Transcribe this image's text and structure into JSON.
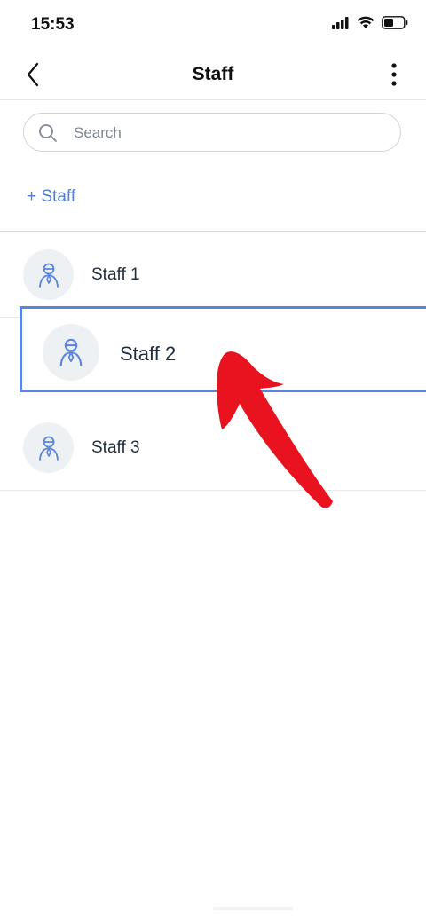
{
  "status_bar": {
    "time": "15:53"
  },
  "nav": {
    "title": "Staff"
  },
  "search": {
    "placeholder": "Search"
  },
  "add_staff_label": "+ Staff",
  "staff": [
    {
      "name": "Staff 1"
    },
    {
      "name": "Staff 2"
    },
    {
      "name": "Staff 3"
    }
  ],
  "colors": {
    "accent": "#4f7fd6",
    "highlight_border": "#5a84e0",
    "annotation_arrow": "#e8131f",
    "avatar_bg": "#eef1f4",
    "text": "#1f2d3d"
  },
  "icons": [
    "cellular-signal-icon",
    "wifi-icon",
    "battery-icon",
    "back-chevron-icon",
    "more-vertical-icon",
    "search-icon",
    "staff-person-icon",
    "annotation-arrow"
  ]
}
